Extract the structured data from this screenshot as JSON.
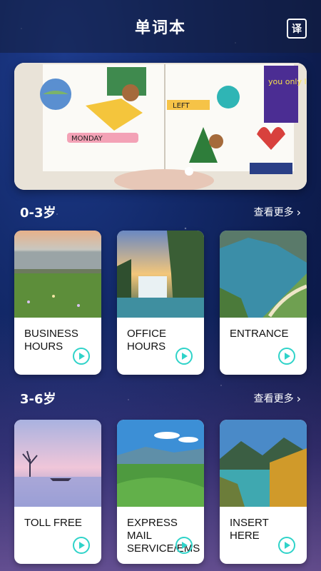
{
  "header": {
    "title": "单词本",
    "translate_icon_label": "译"
  },
  "banner": {
    "name": "journal-banner"
  },
  "sections": [
    {
      "title": "0-3岁",
      "more": "查看更多",
      "cards": [
        {
          "label": "BUSINESS HOURS"
        },
        {
          "label": "OFFICE HOURS"
        },
        {
          "label": "ENTRANCE"
        }
      ]
    },
    {
      "title": "3-6岁",
      "more": "查看更多",
      "cards": [
        {
          "label": "TOLL FREE"
        },
        {
          "label": "EXPRESS MAIL SERVICE/EMS"
        },
        {
          "label": "INSERT HERE"
        }
      ]
    }
  ],
  "colors": {
    "play": "#2fd3c9",
    "card_bg": "#ffffff",
    "header_bg": "#1a2a52"
  },
  "banner_texts": {
    "monday": "MONDAY",
    "left": "LEFT",
    "you_only": "you only live once"
  }
}
